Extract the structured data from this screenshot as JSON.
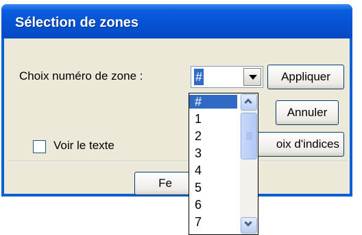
{
  "window": {
    "title": "Sélection de zones"
  },
  "form": {
    "zone_label": "Choix numéro de zone :",
    "zone_value": "#",
    "show_text_label": "Voir le texte"
  },
  "buttons": {
    "apply": "Appliquer",
    "cancel": "Annuler",
    "indices": "oix d'indices",
    "close": "Fe"
  },
  "dropdown": {
    "options": [
      "#",
      "1",
      "2",
      "3",
      "4",
      "5",
      "6",
      "7"
    ],
    "selected": "#"
  },
  "icons": {
    "combo_arrow": "chevron-down-icon",
    "scroll_up": "chevron-up-icon",
    "scroll_down": "chevron-down-icon",
    "scroll_grip": "grip-icon"
  }
}
